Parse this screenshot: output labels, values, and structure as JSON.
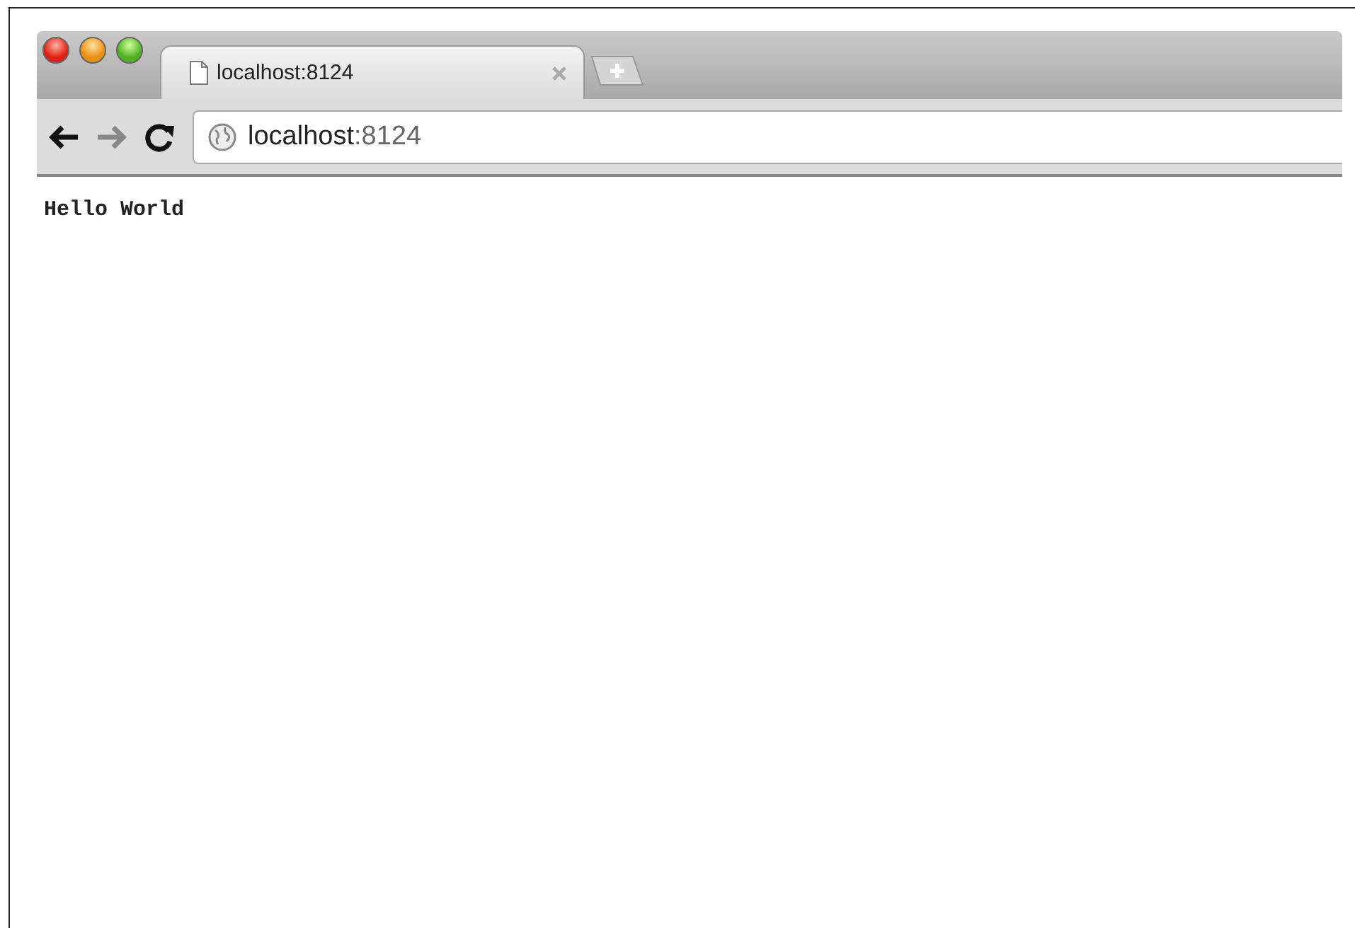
{
  "tabs": [
    {
      "title": "localhost:8124",
      "selected": true,
      "kind": "page"
    }
  ],
  "toolbar": {
    "back": {
      "disabled": false
    },
    "forward": {
      "disabled": true
    }
  },
  "address": {
    "host": "localhost",
    "port": ":8124"
  },
  "page": {
    "text": "Hello World"
  }
}
